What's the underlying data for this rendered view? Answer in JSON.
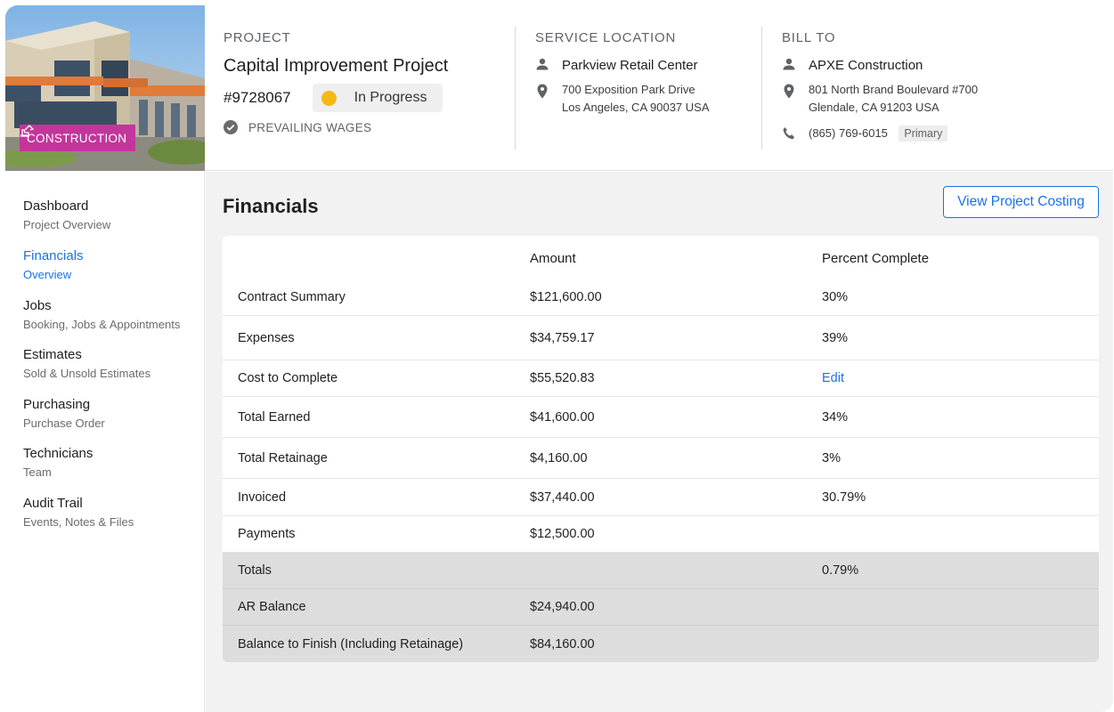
{
  "header": {
    "badge": "CONSTRUCTION",
    "project": {
      "caption": "PROJECT",
      "name": "Capital Improvement Project",
      "number": "#9728067",
      "status": "In Progress",
      "status_color": "#f6b812",
      "wages": "PREVAILING WAGES"
    },
    "service_location": {
      "caption": "SERVICE LOCATION",
      "name": "Parkview Retail Center",
      "address_line1": "700 Exposition Park Drive",
      "address_line2": "Los Angeles, CA 90037 USA"
    },
    "bill_to": {
      "caption": "BILL TO",
      "name": "APXE Construction",
      "address_line1": "801 North Brand Boulevard #700",
      "address_line2": "Glendale, CA 91203 USA",
      "phone": "(865) 769-6015",
      "phone_badge": "Primary"
    }
  },
  "sidebar": {
    "items": [
      {
        "title": "Dashboard",
        "sub": "Project Overview",
        "active": false
      },
      {
        "title": "Financials",
        "sub": "Overview",
        "active": true
      },
      {
        "title": "Jobs",
        "sub": "Booking, Jobs & Appointments",
        "active": false
      },
      {
        "title": "Estimates",
        "sub": "Sold & Unsold Estimates",
        "active": false
      },
      {
        "title": "Purchasing",
        "sub": "Purchase Order",
        "active": false
      },
      {
        "title": "Technicians",
        "sub": "Team",
        "active": false
      },
      {
        "title": "Audit Trail",
        "sub": "Events, Notes & Files",
        "active": false
      }
    ]
  },
  "main": {
    "title": "Financials",
    "button": "View Project Costing",
    "table": {
      "headers": [
        "",
        "Amount",
        "Percent Complete"
      ],
      "rows": [
        {
          "label": "Contract Summary",
          "amount": "$121,600.00",
          "percent": "30%"
        },
        {
          "label": "Expenses",
          "amount": "$34,759.17",
          "percent": "39%"
        },
        {
          "label": "Cost to Complete",
          "amount": "$55,520.83",
          "percent": "Edit"
        },
        {
          "label": "Total Earned",
          "amount": "$41,600.00",
          "percent": "34%"
        },
        {
          "label": "Total Retainage",
          "amount": "$4,160.00",
          "percent": "3%"
        },
        {
          "label": "Invoiced",
          "amount": "$37,440.00",
          "percent": "30.79%"
        },
        {
          "label": "Payments",
          "amount": "$12,500.00",
          "percent": ""
        },
        {
          "label": "Totals",
          "amount": "",
          "percent": "0.79%"
        },
        {
          "label": "AR Balance",
          "amount": "$24,940.00",
          "percent": ""
        },
        {
          "label": "Balance to Finish (Including Retainage)",
          "amount": "$84,160.00",
          "percent": ""
        }
      ]
    }
  },
  "colors": {
    "accent": "#1a73e8",
    "badge": "#c2369b"
  }
}
